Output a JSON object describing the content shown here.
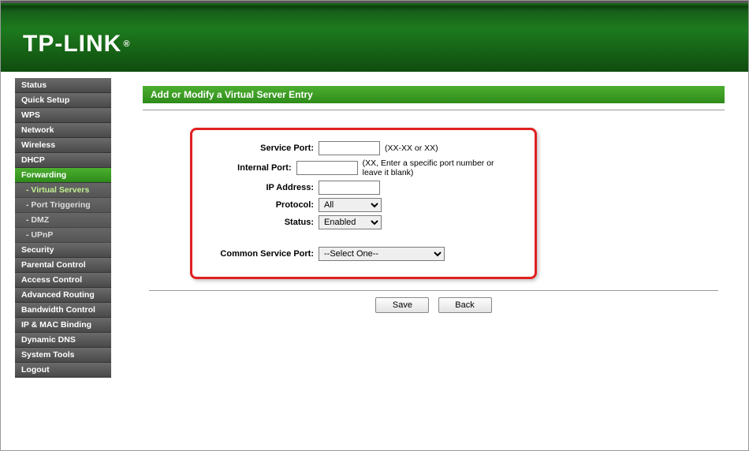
{
  "logo_text": "TP-LINK",
  "page_title": "Add or Modify a Virtual Server Entry",
  "nav": [
    {
      "label": "Status",
      "type": "item"
    },
    {
      "label": "Quick Setup",
      "type": "item"
    },
    {
      "label": "WPS",
      "type": "item"
    },
    {
      "label": "Network",
      "type": "item"
    },
    {
      "label": "Wireless",
      "type": "item"
    },
    {
      "label": "DHCP",
      "type": "item"
    },
    {
      "label": "Forwarding",
      "type": "item-active"
    },
    {
      "label": "- Virtual Servers",
      "type": "sub-active"
    },
    {
      "label": "- Port Triggering",
      "type": "sub"
    },
    {
      "label": "- DMZ",
      "type": "sub"
    },
    {
      "label": "- UPnP",
      "type": "sub"
    },
    {
      "label": "Security",
      "type": "item"
    },
    {
      "label": "Parental Control",
      "type": "item"
    },
    {
      "label": "Access Control",
      "type": "item"
    },
    {
      "label": "Advanced Routing",
      "type": "item"
    },
    {
      "label": "Bandwidth Control",
      "type": "item"
    },
    {
      "label": "IP & MAC Binding",
      "type": "item"
    },
    {
      "label": "Dynamic DNS",
      "type": "item"
    },
    {
      "label": "System Tools",
      "type": "item"
    },
    {
      "label": "Logout",
      "type": "item"
    }
  ],
  "form": {
    "service_port_label": "Service Port:",
    "service_port_value": "",
    "service_port_hint": "(XX-XX or XX)",
    "internal_port_label": "Internal Port:",
    "internal_port_value": "",
    "internal_port_hint": "(XX, Enter a specific port number or leave it blank)",
    "ip_address_label": "IP Address:",
    "ip_address_value": "",
    "protocol_label": "Protocol:",
    "protocol_value": "All",
    "status_label": "Status:",
    "status_value": "Enabled",
    "common_service_port_label": "Common Service Port:",
    "common_service_port_value": "--Select One--"
  },
  "buttons": {
    "save": "Save",
    "back": "Back"
  }
}
